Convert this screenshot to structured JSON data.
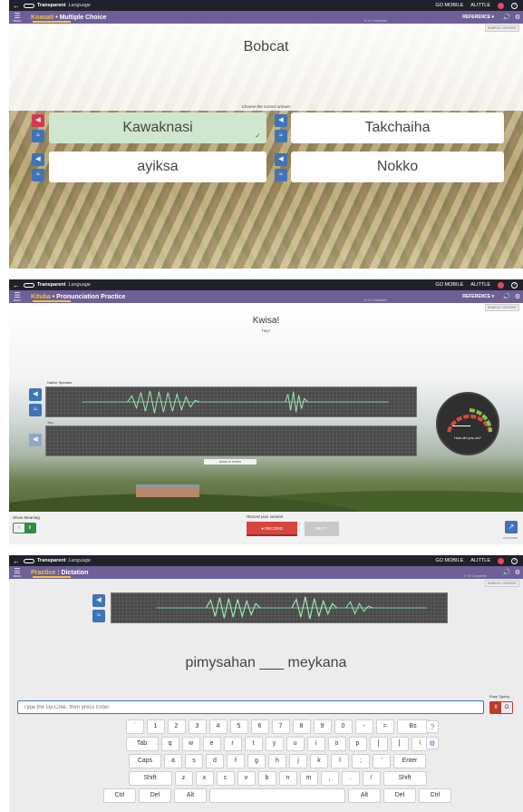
{
  "app": {
    "brand": "Transparent",
    "brand_suffix": "Language",
    "go_mobile": "GO MOBILE",
    "user_menu": "ALITTLE",
    "reference": "REFERENCE",
    "menu_label": "MENU"
  },
  "panel1": {
    "lang": "Koasati",
    "activity": " • Multiple Choice",
    "complete": "0 % Complete",
    "tag": "SAMPLE CONTENT",
    "prompt": "Bobcat",
    "instruction": "Choose the correct answer",
    "answers": [
      {
        "text": "Kawaknasi",
        "state": "correct"
      },
      {
        "text": "Takchaiha",
        "state": "default"
      },
      {
        "text": "ayiksa",
        "state": "default"
      },
      {
        "text": "Nokko",
        "state": "default"
      }
    ]
  },
  "panel2": {
    "lang": "Kituba",
    "activity": " • Pronunciation Practice",
    "complete": "0 % Complete",
    "tag": "SAMPLE CONTENT",
    "word": "Kwisa!",
    "meaning": "hey!",
    "native_label": "Native Speaker",
    "you_label": "You",
    "areas_label": "Areas to review",
    "gauge_text": "How did you do?",
    "show_meaning": "Show Meaning",
    "record_label": "Record your version",
    "record_button": "RECORD",
    "next_button": "NEXT",
    "id": "KIN-123456"
  },
  "panel3": {
    "lang": "Practice",
    "activity": " : Dictation",
    "complete": "0 % Complete",
    "tag": "SAMPLE CONTENT",
    "sentence": "pimysahan ___ meykana",
    "input_placeholder": "Type the Oji-Cree, then press Enter",
    "easy_typing": "Easy Typing",
    "keyboard": {
      "row1": [
        "`",
        "1",
        "2",
        "3",
        "4",
        "5",
        "6",
        "7",
        "8",
        "9",
        "0",
        "-",
        "=",
        "Bs"
      ],
      "row2": [
        "Tab",
        "q",
        "w",
        "e",
        "r",
        "t",
        "y",
        "u",
        "i",
        "o",
        "p",
        "[",
        "]",
        "\\"
      ],
      "row3": [
        "Caps",
        "a",
        "s",
        "d",
        "f",
        "g",
        "h",
        "j",
        "k",
        "l",
        ";",
        "'",
        "Enter"
      ],
      "row4": [
        "Shift",
        "z",
        "x",
        "c",
        "v",
        "b",
        "n",
        "m",
        ",",
        ".",
        "/",
        "Shift"
      ],
      "row5": [
        "Ctrl",
        "Del",
        "Alt",
        " ",
        "Alt",
        "Del",
        "Ctrl"
      ]
    }
  }
}
